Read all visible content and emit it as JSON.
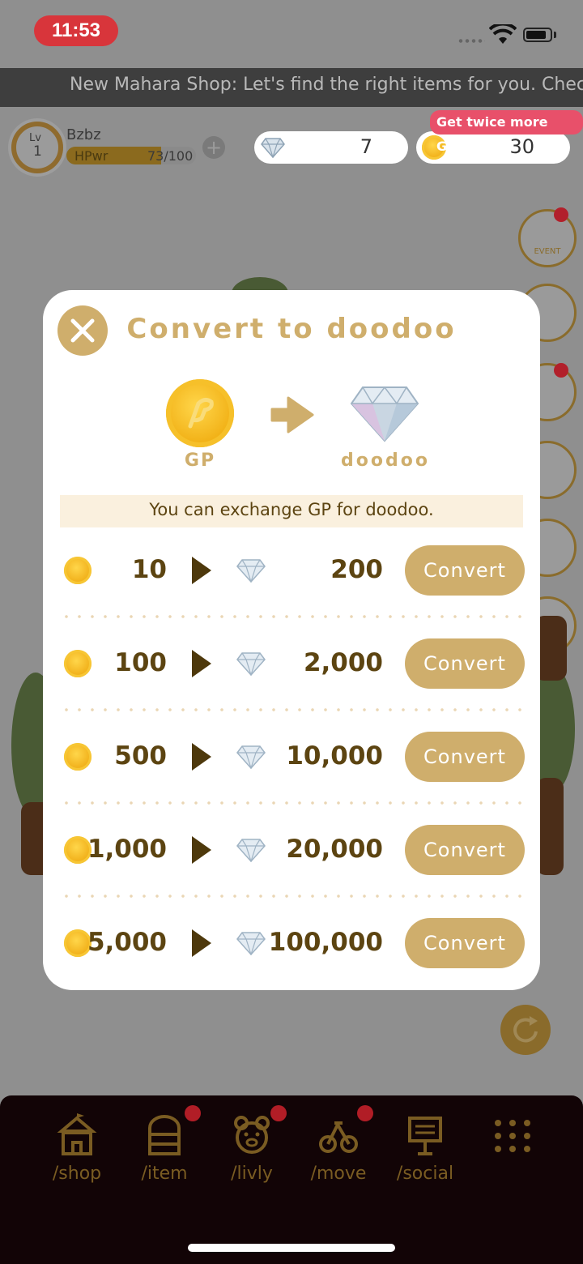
{
  "status_bar": {
    "time": "11:53"
  },
  "ticker": {
    "text": "New Mahara Shop: Let's find the right items for you. Check"
  },
  "player": {
    "level_label": "Lv",
    "level": "1",
    "name": "Bzbz",
    "hp_label": "HPwr",
    "hp_value": "73/100",
    "hp_fraction": 0.73
  },
  "currency": {
    "doodoo": "7",
    "gp": "30",
    "promo": "Get twice more GP!"
  },
  "side_buttons": {
    "event_label": "EVENT"
  },
  "modal": {
    "title": "Convert to doodoo",
    "from_label": "GP",
    "to_label": "doodoo",
    "info": "You can exchange GP for doodoo.",
    "rows": [
      {
        "gp": "10",
        "doodoo": "200",
        "button": "Convert"
      },
      {
        "gp": "100",
        "doodoo": "2,000",
        "button": "Convert"
      },
      {
        "gp": "500",
        "doodoo": "10,000",
        "button": "Convert"
      },
      {
        "gp": "1,000",
        "doodoo": "20,000",
        "button": "Convert"
      },
      {
        "gp": "5,000",
        "doodoo": "100,000",
        "button": "Convert"
      }
    ]
  },
  "bottom_nav": {
    "items": [
      {
        "label": "/shop",
        "icon": "shop-tent-icon"
      },
      {
        "label": "/item",
        "icon": "chest-icon"
      },
      {
        "label": "/livly",
        "icon": "bear-face-icon"
      },
      {
        "label": "/move",
        "icon": "bicycle-icon"
      },
      {
        "label": "/social",
        "icon": "signboard-icon"
      },
      {
        "label": "",
        "icon": "grid-menu-icon"
      }
    ]
  },
  "colors": {
    "accent": "#cfae6c",
    "text_dark": "#5c4411",
    "badge": "#b11d26"
  }
}
